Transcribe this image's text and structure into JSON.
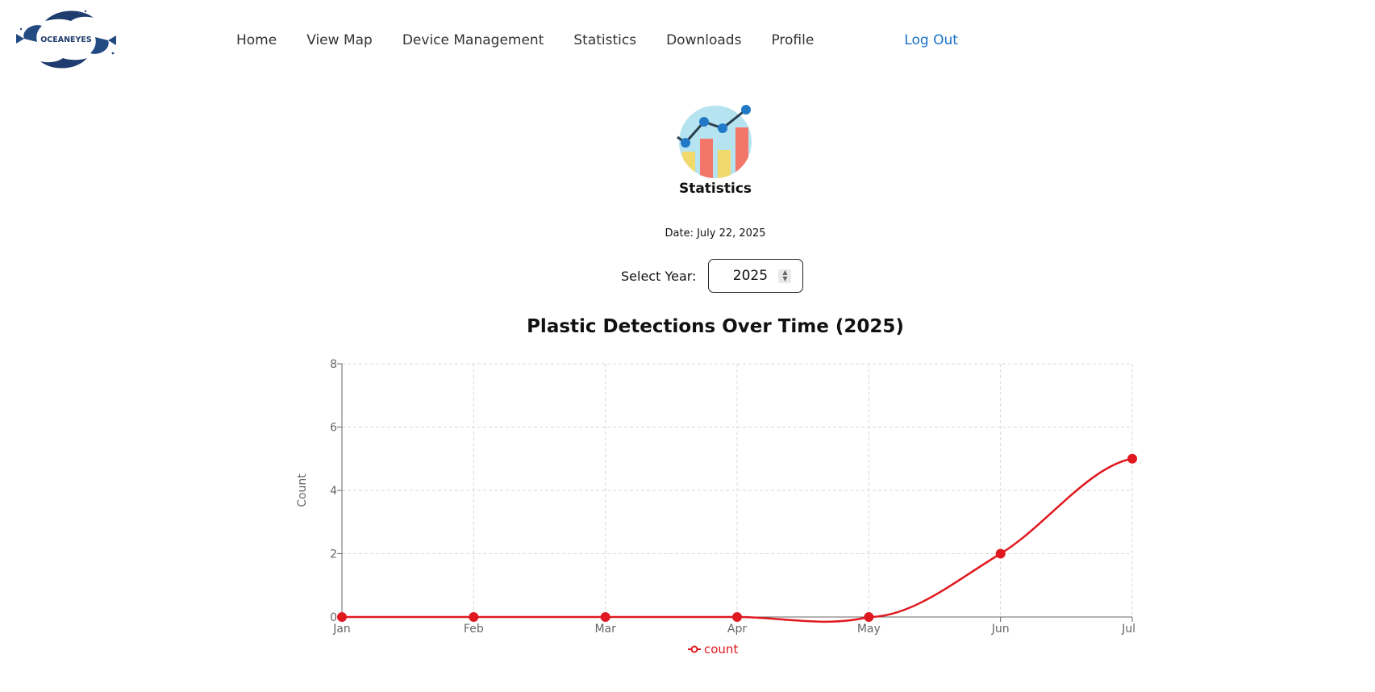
{
  "brand": {
    "logo_text": "OCEANEYES"
  },
  "nav": {
    "items": [
      "Home",
      "View Map",
      "Device Management",
      "Statistics",
      "Downloads",
      "Profile"
    ],
    "logout": "Log Out"
  },
  "page": {
    "title": "Statistics",
    "date": "Date: July 22, 2025"
  },
  "year_select": {
    "label": "Select Year:",
    "value": "2025"
  },
  "colors": {
    "accent": "#1a73c8",
    "series": "#e0181f",
    "grid": "#d9d9d9",
    "axis": "#666666"
  },
  "chart_data": {
    "type": "line",
    "title": "Plastic Detections Over Time (2025)",
    "xlabel": "",
    "ylabel": "Count",
    "categories": [
      "Jan",
      "Feb",
      "Mar",
      "Apr",
      "May",
      "Jun",
      "Jul"
    ],
    "series": [
      {
        "name": "count",
        "values": [
          0,
          0,
          0,
          0,
          0,
          2,
          5
        ]
      }
    ],
    "ylim": [
      0,
      8
    ],
    "yticks": [
      0,
      2,
      4,
      6,
      8
    ],
    "grid": true,
    "legend_position": "bottom"
  }
}
